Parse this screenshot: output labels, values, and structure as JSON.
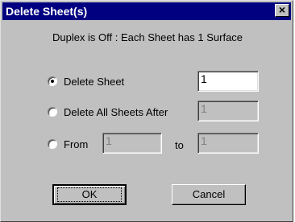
{
  "dialog": {
    "title": "Delete Sheet(s)",
    "close_glyph": "×",
    "info_text": "Duplex is Off : Each Sheet has 1 Surface"
  },
  "options": {
    "delete_sheet": {
      "label": "Delete Sheet",
      "value": "1",
      "selected": true
    },
    "delete_all_after": {
      "label": "Delete All Sheets After",
      "value": "1",
      "selected": false
    },
    "from": {
      "label": "From",
      "from_value": "1",
      "to_label": "to",
      "to_value": "1",
      "selected": false
    }
  },
  "buttons": {
    "ok": "OK",
    "cancel": "Cancel"
  },
  "colors": {
    "titlebar": "#000080",
    "face": "#c0c0c0"
  }
}
